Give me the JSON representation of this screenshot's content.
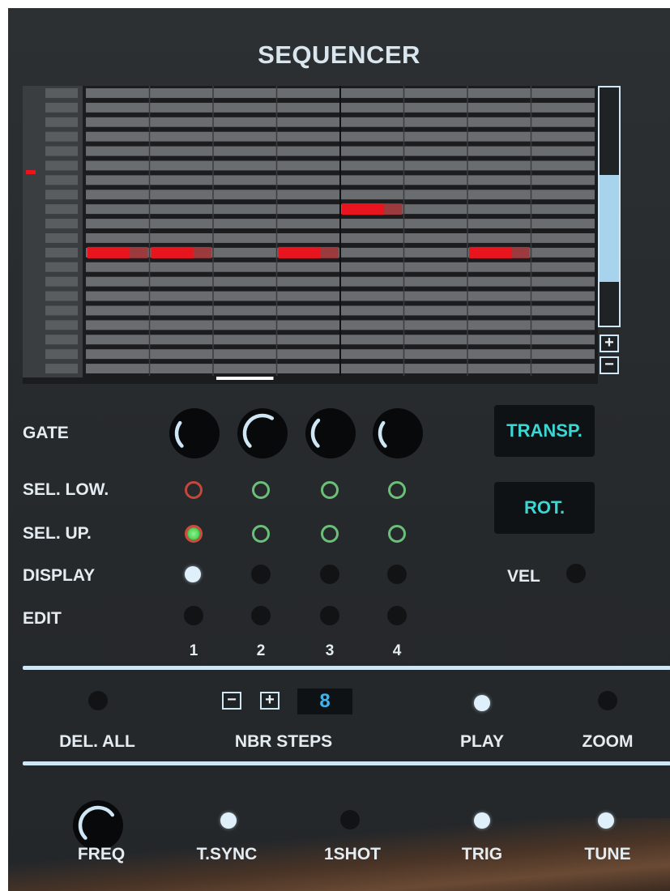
{
  "title": "SEQUENCER",
  "roll": {
    "columns": 8,
    "rows": 20,
    "notes": [
      {
        "col": 0,
        "row": 11
      },
      {
        "col": 1,
        "row": 11
      },
      {
        "col": 3,
        "row": 11
      },
      {
        "col": 4,
        "row": 8
      },
      {
        "col": 6,
        "row": 11
      }
    ],
    "playhead_col": 2,
    "note_color": "#e8141e",
    "note_tail_color": "#9b3b3e"
  },
  "scroll": {
    "plus": "+",
    "minus": "−"
  },
  "rows": {
    "gate": "GATE",
    "sel_low": "SEL. LOW.",
    "sel_up": "SEL. UP.",
    "display": "DISPLAY",
    "edit": "EDIT"
  },
  "lanes": [
    "1",
    "2",
    "3",
    "4"
  ],
  "gate_knob_values": [
    0.3,
    0.62,
    0.34,
    0.3
  ],
  "transp_label": "TRANSP.",
  "rot_label": "ROT.",
  "vel_label": "VEL",
  "steps": {
    "del_all": "DEL. ALL",
    "nbr_steps": "NBR STEPS",
    "minus": "−",
    "plus": "+",
    "value": "8",
    "play": "PLAY",
    "zoom": "ZOOM"
  },
  "bottom": {
    "freq": "FREQ",
    "tsync": "T.SYNC",
    "oneshot": "1SHOT",
    "trig": "TRIG",
    "tune": "TUNE",
    "freq_knob_value": 0.7
  },
  "colors": {
    "accent": "#cfe6f4",
    "teal_text": "#3cd7d3",
    "ring_green": "#6bbf79",
    "ring_red": "#c3473a"
  }
}
